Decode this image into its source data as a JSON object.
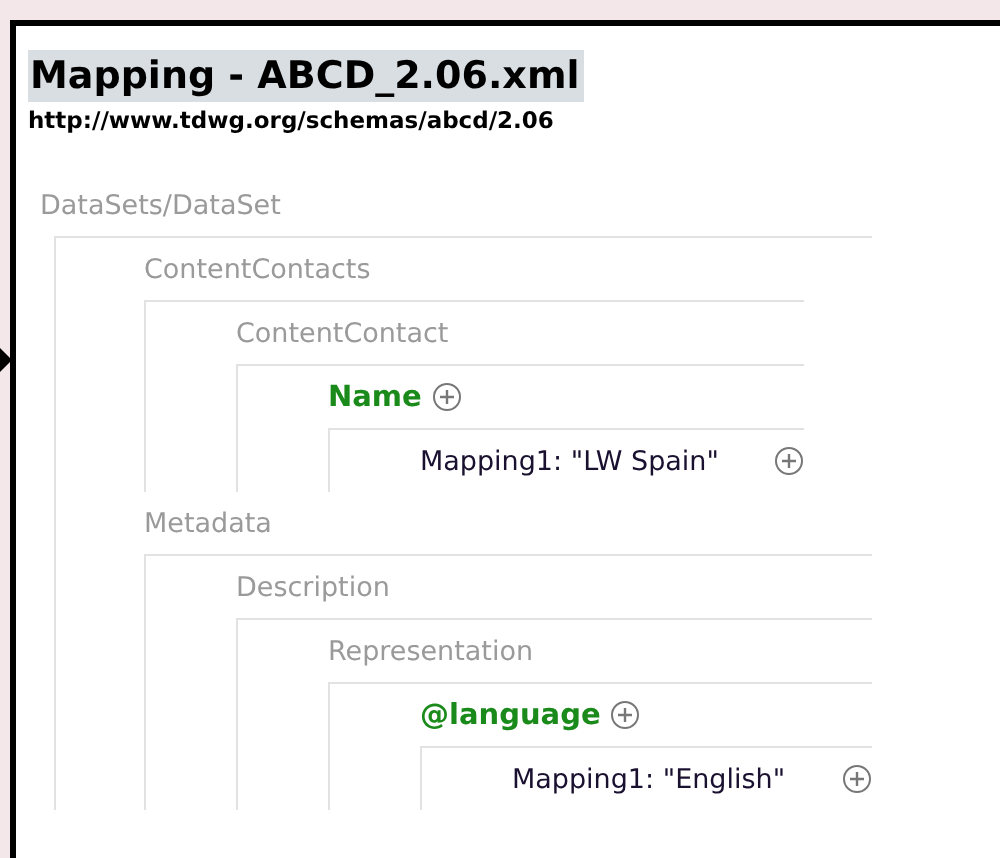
{
  "title": "Mapping - ABCD_2.06.xml",
  "namespace": "http://www.tdwg.org/schemas/abcd/2.06",
  "tree": [
    {
      "label": "DataSets/DataSet",
      "kind": "element",
      "children": [
        {
          "label": "ContentContacts",
          "kind": "element",
          "children": [
            {
              "label": "ContentContact",
              "kind": "element",
              "children": [
                {
                  "label": "Name",
                  "kind": "mapped",
                  "children": [
                    {
                      "label": "Mapping1: \"LW Spain\"",
                      "kind": "mapping"
                    }
                  ]
                }
              ]
            }
          ]
        },
        {
          "label": "Metadata",
          "kind": "element",
          "children": [
            {
              "label": "Description",
              "kind": "element",
              "children": [
                {
                  "label": "Representation",
                  "kind": "element",
                  "children": [
                    {
                      "label": "@language",
                      "kind": "mapped",
                      "children": [
                        {
                          "label": "Mapping1: \"English\"",
                          "kind": "mapping"
                        }
                      ]
                    }
                  ]
                }
              ]
            }
          ]
        }
      ]
    }
  ]
}
